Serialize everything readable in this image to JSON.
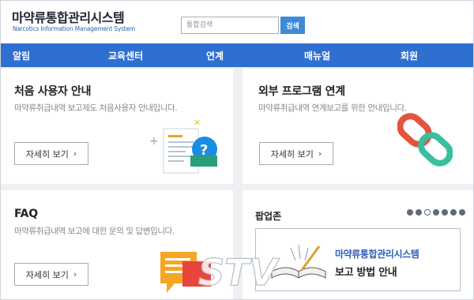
{
  "header": {
    "logo_ko": "마약류통합관리시스템",
    "logo_en": "Narcotics Information Management System",
    "search_placeholder": "통합검색",
    "search_button": "검색"
  },
  "nav": {
    "items": [
      "알림",
      "교육센터",
      "연계",
      "매뉴얼",
      "회원"
    ]
  },
  "cards": {
    "first_user": {
      "title": "처음 사용자 안내",
      "desc": "마약류취급내역 보고제도 처음사용자 안내입니다.",
      "button": "자세히 보기"
    },
    "external": {
      "title": "외부 프로그램 연계",
      "desc": "마약류취급내역 연계보고를 위한 안내입니다.",
      "button": "자세히 보기"
    },
    "faq": {
      "title": "FAQ",
      "desc": "마약류취급내역 보고에 대한 문의 및 답변입니다.",
      "button": "자세히 보기"
    },
    "popup": {
      "title": "팝업존",
      "banner_line1": "마약류통합관리시스템",
      "banner_line2": "보고 방법 안내",
      "slide_count": 7,
      "active_slide": 3
    }
  },
  "watermark": {
    "text": "STV"
  },
  "colors": {
    "nav_bg": "#2f6fd0",
    "search_btn": "#3f8ad8",
    "page_bg": "#eef0f3",
    "banner_accent": "#2b5db8"
  }
}
